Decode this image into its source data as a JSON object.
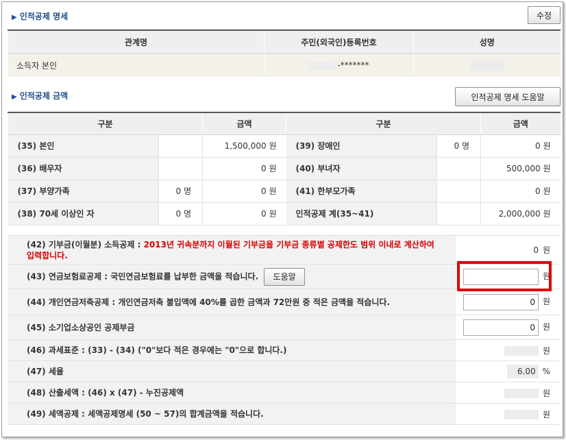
{
  "section1": {
    "title": "인적공제 명세",
    "edit_button": "수정",
    "headers": [
      "관계명",
      "주민(외국인)등록번호",
      "성명"
    ],
    "row": {
      "relation": "소득자 본인",
      "ssn": "-*******",
      "name": ""
    }
  },
  "section2": {
    "title": "인적공제 금액",
    "help_button": "인적공제 명세 도움말",
    "headers": [
      "구분",
      "금액",
      "구분",
      "금액"
    ],
    "rows": [
      {
        "l_label": "(35) 본인",
        "l_count": "",
        "l_amount": "1,500,000 원",
        "r_label": "(39) 장애인",
        "r_count": "0 명",
        "r_amount": "0 원"
      },
      {
        "l_label": "(36) 배우자",
        "l_count": "",
        "l_amount": "0 원",
        "r_label": "(40) 부녀자",
        "r_count": "",
        "r_amount": "500,000 원"
      },
      {
        "l_label": "(37) 부양가족",
        "l_count": "0 명",
        "l_amount": "0 원",
        "r_label": "(41) 한부모가족",
        "r_count": "",
        "r_amount": "0 원"
      },
      {
        "l_label": "(38) 70세 이상인 자",
        "l_count": "0 명",
        "l_amount": "0 원",
        "r_label": "인적공제 계(35~41)",
        "r_count": "",
        "r_amount": "2,000,000 원"
      }
    ]
  },
  "section3": {
    "rows": [
      {
        "label": "(42) 기부금(이월분) 소득공제 : ",
        "note": "2013년 귀속분까지 이월된 기부금을 기부금 종류별 공제한도 범위 이내로 계산하여 입력합니다.",
        "value": "0",
        "unit": "원"
      },
      {
        "label": "(43) 연금보험료공제 : 국민연금보험료를 납부한 금액을 적습니다.",
        "help": "도움말",
        "input_value": "",
        "unit": "원"
      },
      {
        "label": "(44) 개인연금저축공제 : 개인연금저축 불입액에 40%를 곱한 금액과 72만원 중 적은 금액을 적습니다.",
        "input_value": "0",
        "unit": "원"
      },
      {
        "label": "(45) 소기업소상공인 공제부금",
        "input_value": "0",
        "unit": "원"
      },
      {
        "label": "(46) 과세표준 : (33) - (34) (\"0\"보다 적은 경우에는 \"0\"으로 합니다.)",
        "unit": "원"
      },
      {
        "label": "(47) 세율",
        "value": "6.00",
        "unit": "%"
      },
      {
        "label": "(48) 산출세액 : (46) x (47) -  누진공제액",
        "unit": "원"
      },
      {
        "label": "(49) 세액공제 : 세액공제명세 (50 ~ 57)의 합계금액을 적습니다.",
        "unit": "원"
      }
    ]
  },
  "colors": {
    "title_blue": "#1f4e8c",
    "note_red": "#d40000",
    "highlight": "#e00000"
  }
}
